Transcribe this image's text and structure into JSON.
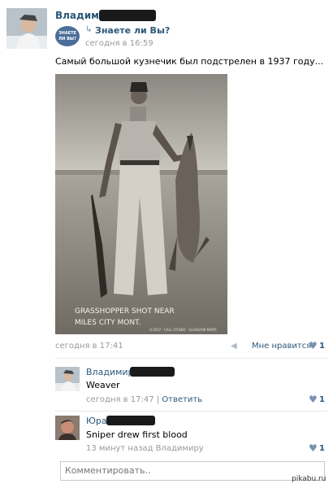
{
  "post": {
    "author_name": "Владимир",
    "group_name": "Знаете ли Вы?",
    "group_logo_text": "ЗНАЕТЕ ЛИ ВЫ?",
    "time": "сегодня в 16:59",
    "text": "Самый большой кузнечик был подстрелен в 1937 году...",
    "photo_caption_line1": "GRASSHOPPER SHOT NEAR",
    "photo_caption_line2": "MILES CITY MONT.",
    "photo_caption_small": "©1937 · CALL STUDIO · GLASGOW MONT.",
    "date": "сегодня в 17:41",
    "like_label": "Мне нравится",
    "like_count": "1"
  },
  "comments": [
    {
      "author": "Владимир",
      "text": "Weaver",
      "time": "сегодня в 17:47",
      "reply_label": "Ответить",
      "like_count": "1"
    },
    {
      "author": "Юра",
      "text": "Sniper drew first blood",
      "time": "13 минут назад",
      "reply_to": "Владимиру",
      "like_count": "1"
    }
  ],
  "comment_input": {
    "placeholder": "Комментировать.."
  },
  "watermark": "pikabu.ru",
  "icons": {
    "repost": "repost-arrow-icon",
    "share": "megaphone-icon",
    "like": "heart-icon"
  },
  "colors": {
    "link": "#2b587a",
    "heart": "#7891b1"
  }
}
